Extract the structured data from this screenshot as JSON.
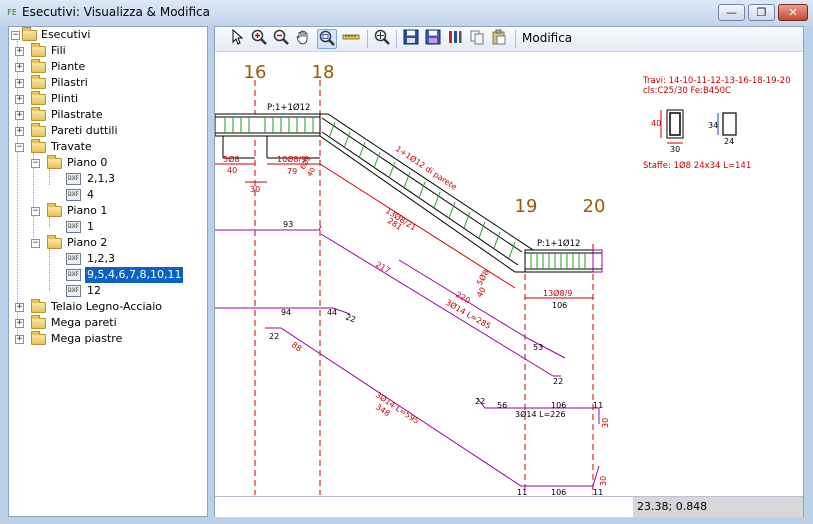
{
  "window": {
    "title": "Esecutivi: Visualizza & Modifica",
    "app_icon": "FE"
  },
  "window_buttons": {
    "minimize": "—",
    "restore": "❐",
    "close": "✕"
  },
  "tree": {
    "root": "Esecutivi",
    "items": {
      "fili": "Fili",
      "piante": "Piante",
      "pilastri": "Pilastri",
      "plinti": "Plinti",
      "pilastrate": "Pilastrate",
      "pareti_duttili": "Pareti duttili",
      "travate": "Travate",
      "piano0": "Piano 0",
      "p0_a": "2,1,3",
      "p0_b": "4",
      "piano1": "Piano 1",
      "p1_a": "1",
      "piano2": "Piano 2",
      "p2_a": "1,2,3",
      "p2_b": "9,5,4,6,7,8,10,11",
      "p2_c": "12",
      "telaio": "Telaio Legno-Acciaio",
      "mega_pareti": "Mega pareti",
      "mega_piastre": "Mega piastre"
    },
    "dxf_icon": "DXF"
  },
  "toolbar": {
    "icons": [
      "pointer-icon",
      "zoom-in-icon",
      "zoom-out-icon",
      "pan-hand-icon",
      "zoom-window-icon",
      "measure-ruler-icon",
      "zoom-extents-icon",
      "save-icon",
      "save-as-icon",
      "tools-icon",
      "copy-icon",
      "paste-icon"
    ],
    "modifica_label": "Modifica"
  },
  "drawing": {
    "axes": {
      "a16": "16",
      "a18": "18",
      "a19": "19",
      "a20": "20"
    },
    "info_line1": "Travi: 14-10-11-12-13-16-18-19-20",
    "info_line2": "cls:C25/30 Fe:B450C",
    "sec_h1": "40",
    "sec_w1": "30",
    "sec_h2": "34",
    "sec_w2": "24",
    "staffe": "Staffe:   1Ø8  24x34  L=141",
    "pl1": "P:1+1Ø12",
    "pl2": "P:1+1Ø12",
    "diag_top": "1+1Ø12 di parete",
    "st1": "5Ø8",
    "st1b": "40",
    "st1c": "30",
    "st2": "10Ø8/9",
    "st2b": "79",
    "st2c": "6Ø8",
    "st2d": "40",
    "st3": "13Ø8/21",
    "st3b": "281",
    "st4": "5Ø8",
    "st4b": "40",
    "st5": "13Ø8/9",
    "st5b": "106",
    "b93": "93",
    "b217": "217",
    "b220": "220",
    "b3o14": "3Ø14  L=285",
    "b53": "53",
    "b22a": "22",
    "b94": "94",
    "b44": "44",
    "b22b": "22",
    "b22c": "22",
    "b88": "88",
    "b3o14b": "3Ø14  L=595",
    "b348": "348",
    "b22d": "22",
    "b56": "56",
    "b106a": "106",
    "b11a": "11",
    "b3o14c": "3Ø14   L=226",
    "b30a": "30",
    "b30b": "30",
    "b11b": "11",
    "b106b": "106",
    "b11c": "11"
  },
  "status": {
    "coords": "23.38; 0.848"
  },
  "colors": {
    "axis_label": "#9a5a00",
    "rebar": "#cc0000",
    "bar_line": "#a000a0",
    "beam_fill": "#1ea01e"
  }
}
